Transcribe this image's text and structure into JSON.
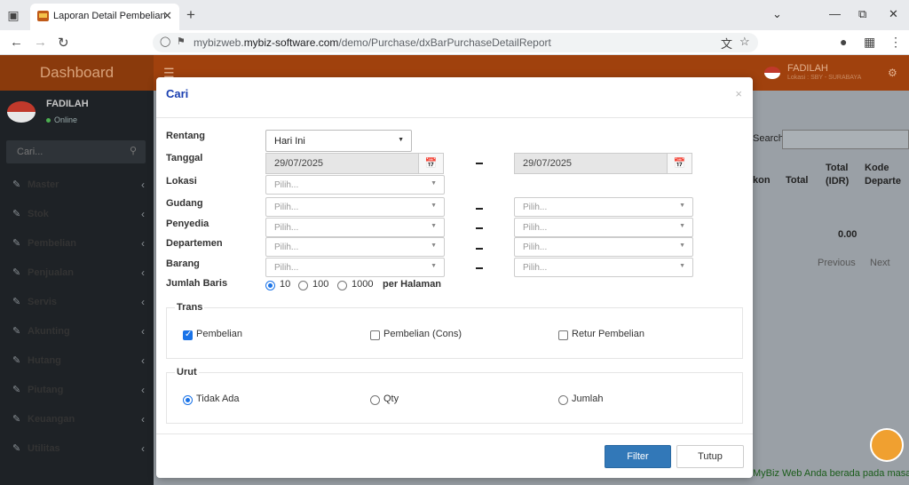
{
  "browser": {
    "tab_title": "Laporan Detail Pembelian",
    "url_prefix": "mybizweb.",
    "url_domain": "mybiz-software.com",
    "url_path": "/demo/Purchase/dxBarPurchaseDetailReport"
  },
  "app": {
    "brand": "Dashboard",
    "header_user": "FADILAH",
    "header_location": "Lokasi : SBY - SURABAYA",
    "sidebar_user": "FADILAH",
    "sidebar_status": "Online",
    "search_placeholder": "Cari...",
    "menu": [
      "Master",
      "Stok",
      "Pembelian",
      "Penjualan",
      "Servis",
      "Akunting",
      "Hutang",
      "Piutang",
      "Keuangan",
      "Utilitas"
    ]
  },
  "background": {
    "search_label": "Search:",
    "col_kon": "kon",
    "col_total": "Total",
    "col_total_idr": "Total (IDR)",
    "col_kode": "Kode Departe",
    "total_value": "0.00",
    "prev": "Previous",
    "next": "Next",
    "footer": "MyBiz Web Anda berada pada masa"
  },
  "modal": {
    "title": "Cari",
    "close": "×",
    "labels": {
      "rentang": "Rentang",
      "tanggal": "Tanggal",
      "lokasi": "Lokasi",
      "gudang": "Gudang",
      "penyedia": "Penyedia",
      "departemen": "Departemen",
      "barang": "Barang",
      "jumlah_baris": "Jumlah Baris"
    },
    "rentang_value": "Hari Ini",
    "date_from": "29/07/2025",
    "date_to": "29/07/2025",
    "placeholder": "Pilih...",
    "rows_options": [
      "10",
      "100",
      "1000"
    ],
    "rows_selected": "10",
    "per_halaman": "per Halaman",
    "trans_legend": "Trans",
    "trans_options": [
      {
        "label": "Pembelian",
        "checked": true
      },
      {
        "label": "Pembelian (Cons)",
        "checked": false
      },
      {
        "label": "Retur Pembelian",
        "checked": false
      }
    ],
    "urut_legend": "Urut",
    "urut_options": [
      "Tidak Ada",
      "Qty",
      "Jumlah"
    ],
    "urut_selected": "Tidak Ada",
    "filter_button": "Filter",
    "tutup_button": "Tutup"
  }
}
